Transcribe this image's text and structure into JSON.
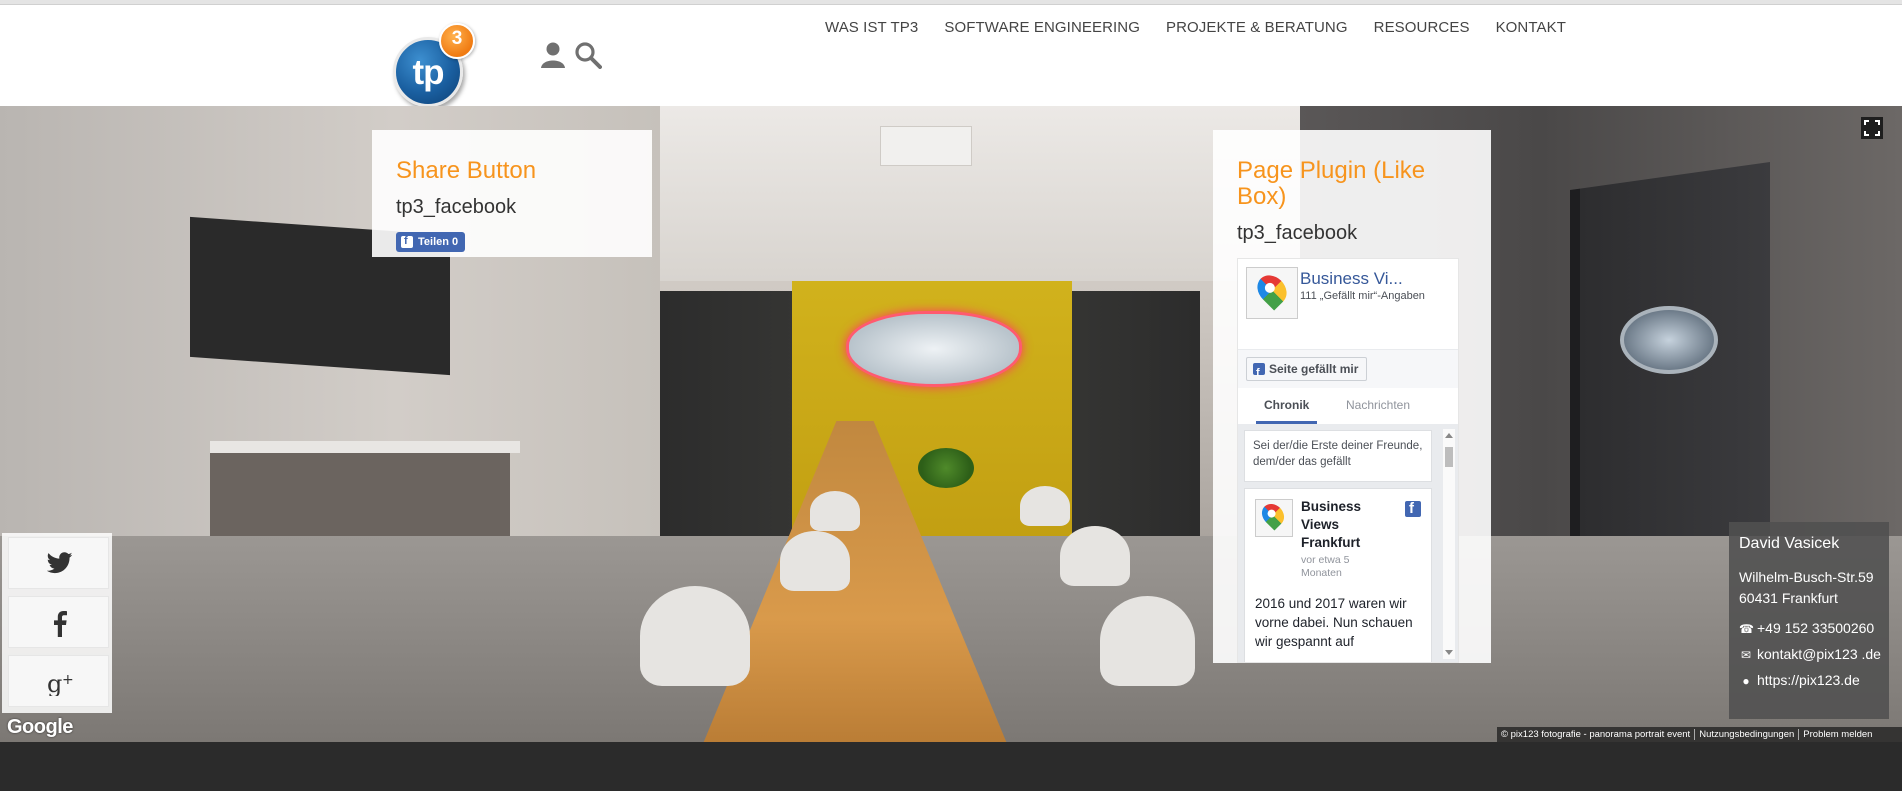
{
  "header": {
    "logo": {
      "main": "tp",
      "sup": "3"
    },
    "icons": [
      "user-icon",
      "search-icon"
    ],
    "nav": [
      "WAS IST TP3",
      "SOFTWARE ENGINEERING",
      "PROJEKTE & BERATUNG",
      "RESOURCES",
      "KONTAKT"
    ]
  },
  "share_widget": {
    "title": "Share Button",
    "subtitle": "tp3_facebook",
    "button_label": "Teilen 0"
  },
  "page_widget": {
    "title": "Page Plugin (Like Box)",
    "subtitle": "tp3_facebook",
    "fb": {
      "page_name": "Business Vi...",
      "likes": "111 „Gefällt mir“-Angaben",
      "like_button": "Seite gefällt mir",
      "tabs": [
        "Chronik",
        "Nachrichten"
      ],
      "friends_note": "Sei der/die Erste deiner Freunde, dem/der das gefällt",
      "post": {
        "name": "Business Views Frankfurt",
        "time": "vor etwa 5 Monaten",
        "text": "2016 und 2017 waren wir vorne dabei. Nun schauen wir gespannt auf"
      }
    }
  },
  "social": [
    "twitter-icon",
    "facebook-icon",
    "google-plus-icon"
  ],
  "google_label": "Google",
  "contact": {
    "name": "David Vasicek",
    "street": "Wilhelm-Busch-Str.59",
    "city": "60431 Frankfurt",
    "phone": "+49 152 33500260",
    "email": "kontakt@pix123 .de",
    "web": "https://pix123.de"
  },
  "footer_links": [
    "© pix123 fotografie - panorama portrait event",
    "Nutzungsbedingungen",
    "Problem melden"
  ],
  "colors": {
    "accent": "#f7941d",
    "facebook": "#4267b2",
    "dark_bar": "#2b2b2b"
  }
}
